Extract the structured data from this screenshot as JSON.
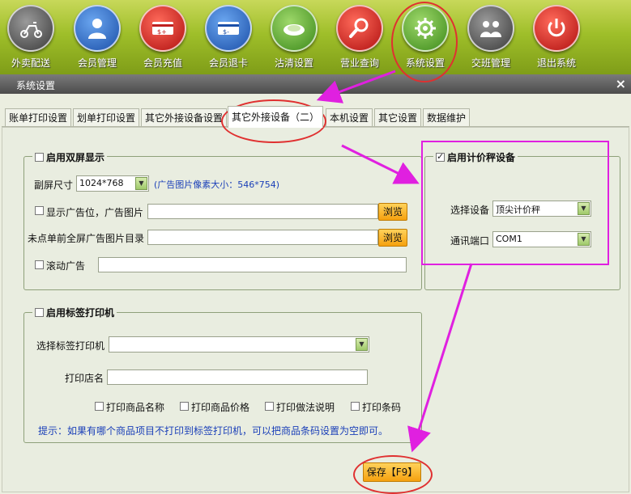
{
  "toolbar": {
    "items": [
      {
        "label": "外卖配送",
        "icon": "scooter-icon"
      },
      {
        "label": "会员管理",
        "icon": "member-icon"
      },
      {
        "label": "会员充值",
        "icon": "card-recharge-icon"
      },
      {
        "label": "会员退卡",
        "icon": "card-refund-icon"
      },
      {
        "label": "沽清设置",
        "icon": "plate-icon"
      },
      {
        "label": "营业查询",
        "icon": "magnifier-icon"
      },
      {
        "label": "系统设置",
        "icon": "gear-icon"
      },
      {
        "label": "交班管理",
        "icon": "shift-icon"
      },
      {
        "label": "退出系统",
        "icon": "power-icon"
      }
    ]
  },
  "dialog": {
    "title": "系统设置",
    "close": "×"
  },
  "tabs": [
    {
      "label": "账单打印设置"
    },
    {
      "label": "划单打印设置"
    },
    {
      "label": "其它外接设备设置"
    },
    {
      "label": "其它外接设备（二）"
    },
    {
      "label": "本机设置"
    },
    {
      "label": "其它设置"
    },
    {
      "label": "数据维护"
    }
  ],
  "dual_screen": {
    "legend": "启用双屏显示",
    "size_label": "副屏尺寸",
    "size_value": "1024*768",
    "size_hint": "(广告图片像素大小：546*754)",
    "show_ad_label": "显示广告位，广告图片",
    "browse1": "浏览",
    "fullscreen_label": "未点单前全屏广告图片目录",
    "browse2": "浏览",
    "scroll_label": "滚动广告"
  },
  "scale": {
    "legend": "启用计价秤设备",
    "device_label": "选择设备",
    "device_value": "顶尖计价秤",
    "port_label": "通讯端口",
    "port_value": "COM1"
  },
  "label_printer": {
    "legend": "启用标签打印机",
    "printer_label": "选择标签打印机",
    "shop_label": "打印店名",
    "opt_name": "打印商品名称",
    "opt_price": "打印商品价格",
    "opt_method": "打印做法说明",
    "opt_barcode": "打印条码",
    "hint": "提示：如果有哪个商品项目不打印到标签打印机，可以把商品条码设置为空即可。"
  },
  "save_label": "保存【F9】"
}
